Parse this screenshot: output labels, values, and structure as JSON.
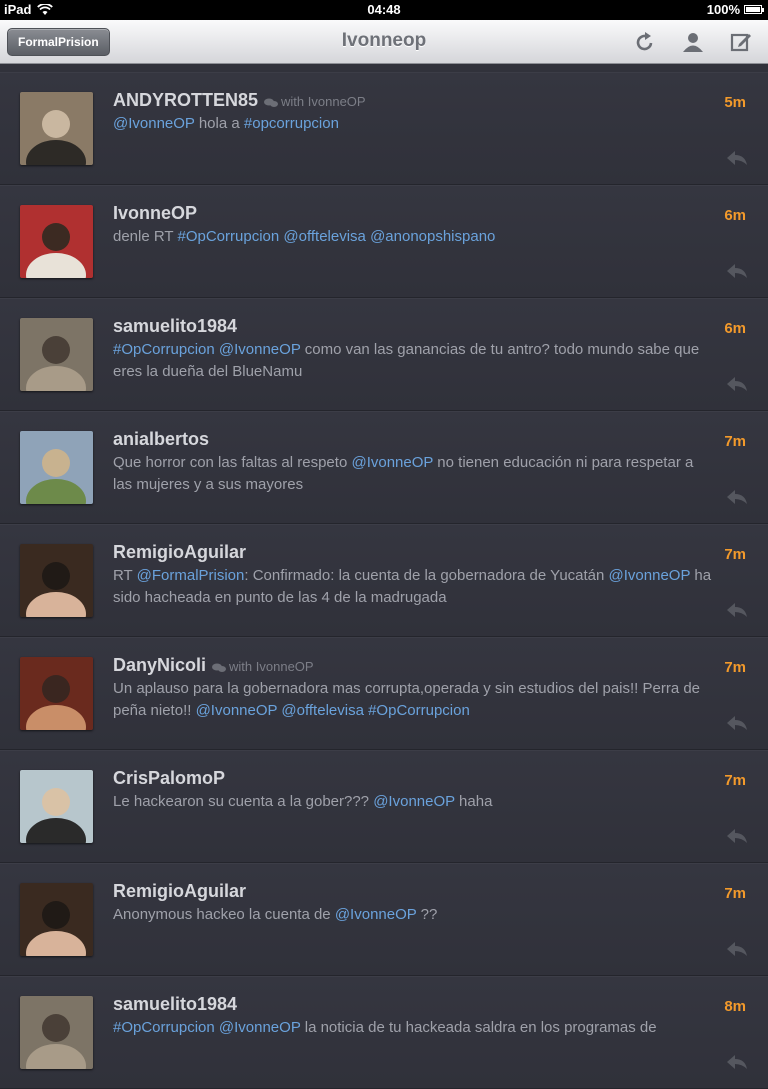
{
  "statusbar": {
    "device": "iPad",
    "time": "04:48",
    "battery": "100%"
  },
  "navbar": {
    "back_label": "FormalPrision",
    "title": "Ivonneop",
    "icons": [
      "refresh-icon",
      "profile-icon",
      "compose-icon"
    ]
  },
  "tweets": [
    {
      "user": "ANDYROTTEN85",
      "convo": "with IvonneOP",
      "time": "5m",
      "parts": [
        [
          "m",
          "@IvonneOP"
        ],
        [
          "t",
          " hola a "
        ],
        [
          "m",
          "#opcorrupcion"
        ]
      ]
    },
    {
      "user": "IvonneOP",
      "convo": "",
      "time": "6m",
      "parts": [
        [
          "t",
          "denle RT "
        ],
        [
          "m",
          "#OpCorrupcion"
        ],
        [
          "t",
          " "
        ],
        [
          "m",
          "@offtelevisa"
        ],
        [
          "t",
          " "
        ],
        [
          "m",
          "@anonopshispano"
        ]
      ]
    },
    {
      "user": "samuelito1984",
      "convo": "",
      "time": "6m",
      "parts": [
        [
          "m",
          "#OpCorrupcion"
        ],
        [
          "t",
          " "
        ],
        [
          "m",
          "@IvonneOP"
        ],
        [
          "t",
          " como van las ganancias de tu antro? todo mundo sabe que eres la dueña del BlueNamu"
        ]
      ]
    },
    {
      "user": "anialbertos",
      "convo": "",
      "time": "7m",
      "parts": [
        [
          "t",
          "Que horror con las faltas al respeto "
        ],
        [
          "m",
          "@IvonneOP"
        ],
        [
          "t",
          " no tienen educación ni para respetar a las mujeres y a sus mayores"
        ]
      ]
    },
    {
      "user": "RemigioAguilar",
      "convo": "",
      "time": "7m",
      "parts": [
        [
          "t",
          "RT "
        ],
        [
          "m",
          "@FormalPrision"
        ],
        [
          "t",
          ": Confirmado: la cuenta de la gobernadora de Yucatán "
        ],
        [
          "m",
          "@IvonneOP"
        ],
        [
          "t",
          "  ha sido hacheada en punto de las 4 de la madrugada"
        ]
      ]
    },
    {
      "user": "DanyNicoli",
      "convo": "with IvonneOP",
      "time": "7m",
      "parts": [
        [
          "t",
          "Un aplauso para la gobernadora mas corrupta,operada y sin estudios del pais!! Perra de peña nieto!!  "
        ],
        [
          "m",
          "@IvonneOP"
        ],
        [
          "t",
          " "
        ],
        [
          "m",
          "@offtelevisa"
        ],
        [
          "t",
          "  "
        ],
        [
          "m",
          "#OpCorrupcion"
        ]
      ]
    },
    {
      "user": "CrisPalomoP",
      "convo": "",
      "time": "7m",
      "parts": [
        [
          "t",
          "Le hackearon su cuenta a la gober??? "
        ],
        [
          "m",
          "@IvonneOP"
        ],
        [
          "t",
          " haha"
        ]
      ]
    },
    {
      "user": "RemigioAguilar",
      "convo": "",
      "time": "7m",
      "parts": [
        [
          "t",
          "Anonymous hackeo la cuenta de "
        ],
        [
          "m",
          "@IvonneOP"
        ],
        [
          "t",
          " ??"
        ]
      ]
    },
    {
      "user": "samuelito1984",
      "convo": "",
      "time": "8m",
      "parts": [
        [
          "m",
          "#OpCorrupcion"
        ],
        [
          "t",
          " "
        ],
        [
          "m",
          "@IvonneOP"
        ],
        [
          "t",
          " la noticia de tu hackeada saldra en los programas de"
        ]
      ]
    }
  ],
  "colors": {
    "mention": "#6aa2dc",
    "time": "#f39a2b",
    "background": "#31323b"
  }
}
